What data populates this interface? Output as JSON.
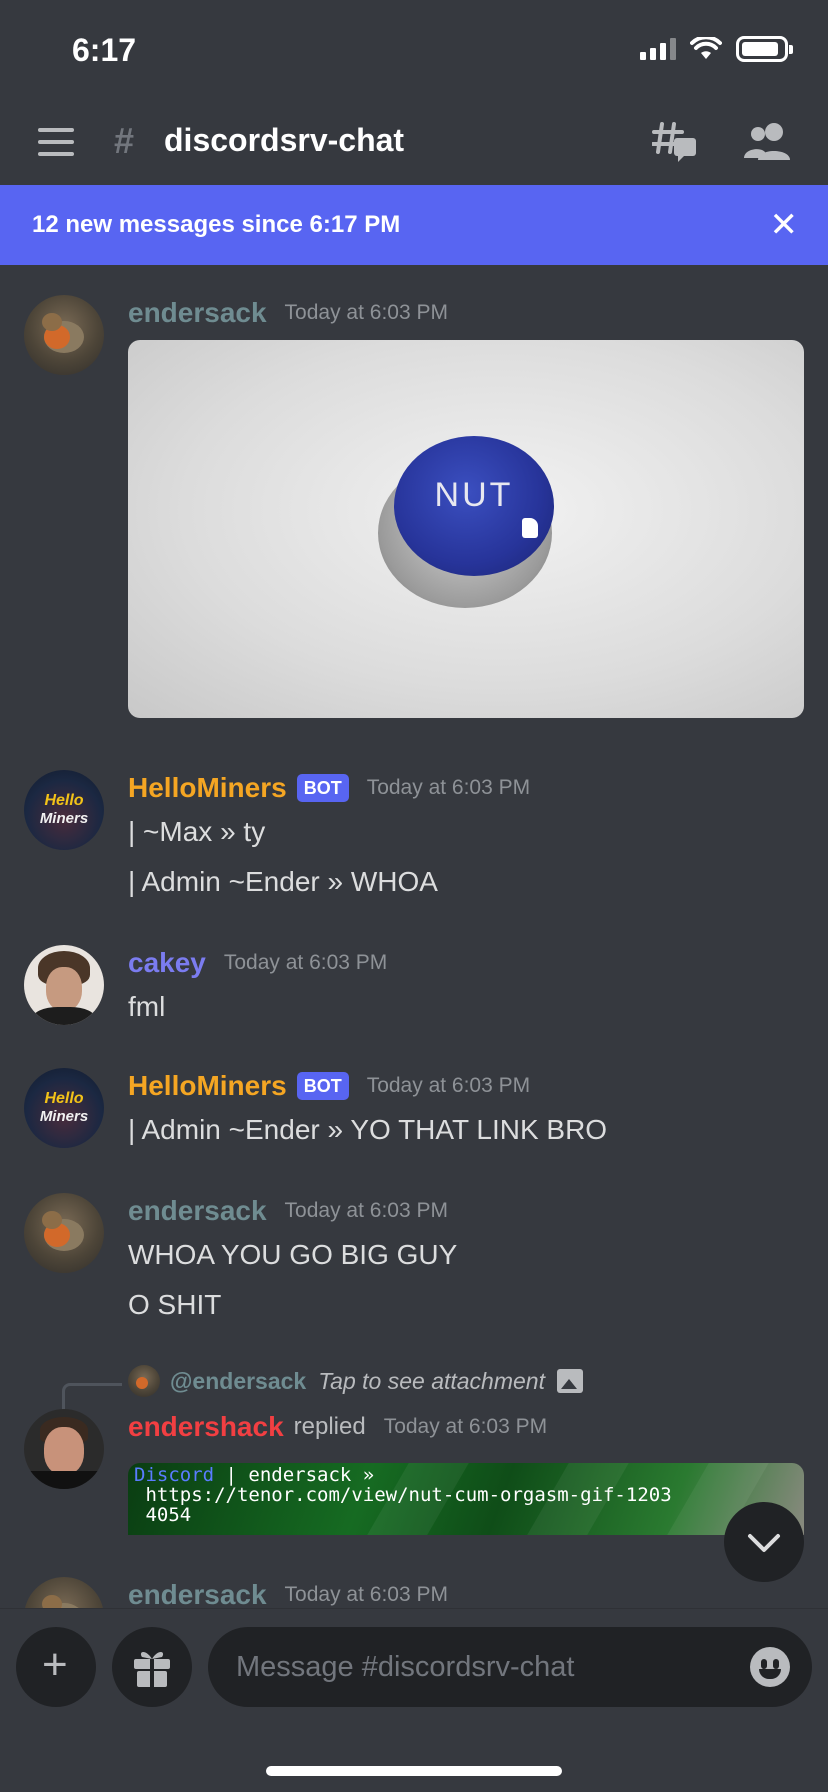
{
  "status_bar": {
    "time": "6:17"
  },
  "header": {
    "channel_name": "discordsrv-chat",
    "hash_symbol": "#"
  },
  "new_messages_bar": {
    "text": "12 new messages since 6:17 PM",
    "close_symbol": "✕"
  },
  "messages": [
    {
      "username": "endersack",
      "timestamp": "Today at 6:03 PM",
      "gif_label": "NUT"
    },
    {
      "username": "HelloMiners",
      "bot_tag": "BOT",
      "timestamp": "Today at 6:03 PM",
      "avatar_text": [
        "Hello",
        "Miners"
      ],
      "lines": [
        "| ~Max » ty",
        "| Admin ~Ender » WHOA"
      ]
    },
    {
      "username": "cakey",
      "timestamp": "Today at 6:03 PM",
      "lines": [
        "fml"
      ]
    },
    {
      "username": "HelloMiners",
      "bot_tag": "BOT",
      "timestamp": "Today at 6:03 PM",
      "avatar_text": [
        "Hello",
        "Miners"
      ],
      "lines": [
        "| Admin ~Ender » YO THAT LINK BRO"
      ]
    },
    {
      "username": "endersack",
      "timestamp": "Today at 6:03 PM",
      "lines": [
        "WHOA YOU GO BIG GUY",
        "O SHIT"
      ]
    },
    {
      "reply_to": "@endersack",
      "reply_text": "Tap to see attachment",
      "username": "endershack",
      "replied_word": "replied",
      "timestamp": "Today at 6:03 PM",
      "embed_lines": {
        "prefix": "Discord",
        "line1_rest": " | endersack »",
        "line2": " https://tenor.com/view/nut-cum-orgasm-gif-1203",
        "line3": " 4054"
      }
    },
    {
      "username": "endersack",
      "timestamp": "Today at 6:03 PM"
    }
  ],
  "input": {
    "placeholder": "Message #discordsrv-chat"
  },
  "colors": {
    "accent": "#5865f2",
    "background": "#36393f",
    "bot_name": "#f5a623",
    "cakey": "#7b7cf0",
    "endershack": "#f23f42",
    "endersack": "#6f8c91"
  }
}
